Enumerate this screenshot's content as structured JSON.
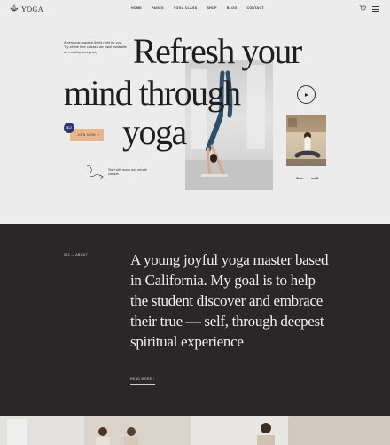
{
  "brand": {
    "name": "YOGA"
  },
  "nav": {
    "items": [
      "HOME",
      "PAGES",
      "YOGA CLASS",
      "SHOP",
      "BLOG",
      "CONTACT"
    ],
    "cart_count": "0"
  },
  "hero": {
    "intro": "A personal practice that's right for you. Try all the free classes we have available on monthly and yearly",
    "headline_1": "Refresh your",
    "headline_2": "mind through",
    "headline_3": "yoga",
    "price_badge": "$12",
    "cta_label": "JOIN NOW",
    "start_text": "Start with group and private classes"
  },
  "about": {
    "label": "002 — ABOUT",
    "text": "A young joyful yoga master based in California. My goal is to help the student discover and embrace their true — self, through deepest spiritual experience",
    "read_more": "READ MORE"
  },
  "colors": {
    "hero_bg": "#ececec",
    "about_bg": "#2a2728",
    "accent_button": "#e8b88a",
    "price_badge": "#2c3472"
  }
}
